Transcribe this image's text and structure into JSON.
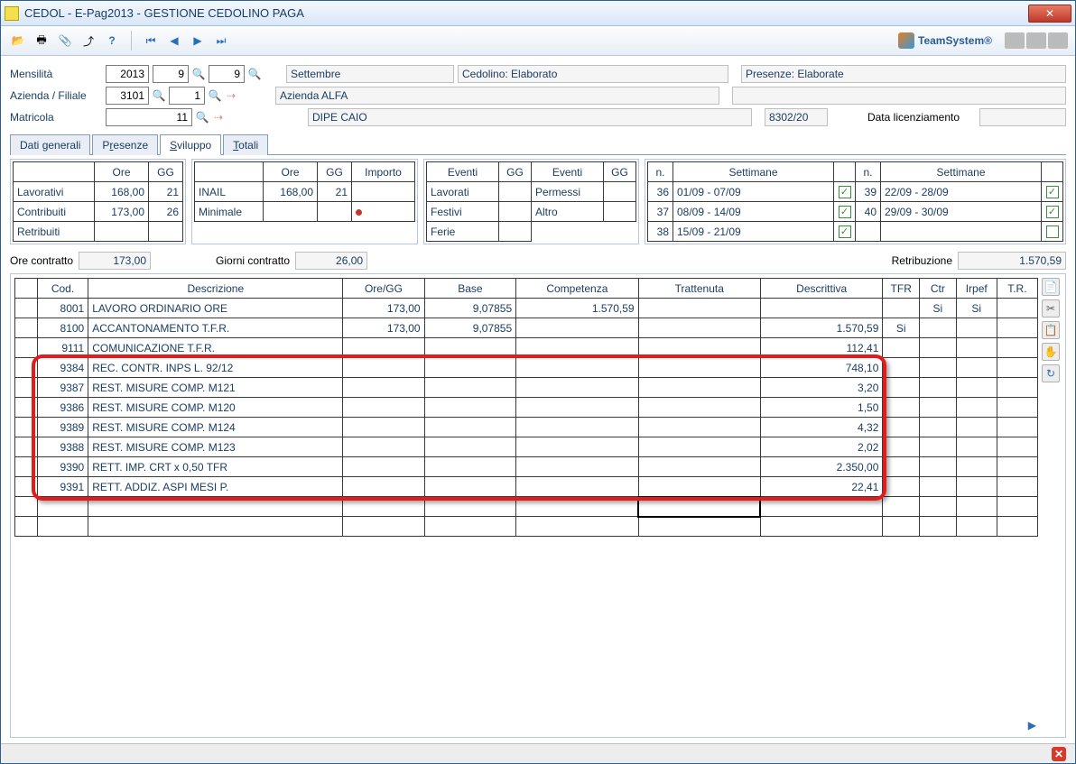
{
  "window": {
    "title": "CEDOL  - E-Pag2013  -  GESTIONE CEDOLINO PAGA"
  },
  "brand": "TeamSystem®",
  "form": {
    "mensilita_label": "Mensilità",
    "azienda_label": "Azienda / Filiale",
    "matricola_label": "Matricola",
    "year": "2013",
    "month1": "9",
    "month2": "9",
    "azienda": "3101",
    "filiale": "1",
    "matricola": "11",
    "month_name": "Settembre",
    "cedolino_status": "Cedolino: Elaborato",
    "presenze_status": "Presenze: Elaborate",
    "azienda_name": "Azienda ALFA",
    "dipe_name": "DIPE CAIO",
    "code": "8302/20",
    "licenziamento_label": "Data licenziamento",
    "licenziamento_value": ""
  },
  "tabs": [
    {
      "label": "Dati generali",
      "hotkey": "g"
    },
    {
      "label": "Presenze",
      "hotkey": "r"
    },
    {
      "label": "Sviluppo",
      "hotkey": "S",
      "active": true
    },
    {
      "label": "Totali",
      "hotkey": "T"
    }
  ],
  "block1": {
    "headers": [
      "",
      "Ore",
      "GG"
    ],
    "rows": [
      [
        "Lavorativi",
        "168,00",
        "21"
      ],
      [
        "Contribuiti",
        "173,00",
        "26"
      ],
      [
        "Retribuiti",
        "",
        ""
      ]
    ]
  },
  "block2": {
    "headers": [
      "",
      "Ore",
      "GG",
      "Importo"
    ],
    "rows": [
      [
        "INAIL",
        "168,00",
        "21",
        ""
      ],
      [
        "Minimale",
        "",
        "",
        ""
      ]
    ]
  },
  "block3": {
    "headers": [
      "Eventi",
      "GG",
      "Eventi",
      "GG"
    ],
    "rows": [
      [
        "Lavorati",
        "",
        "Permessi",
        ""
      ],
      [
        "Festivi",
        "",
        "Altro",
        ""
      ],
      [
        "Ferie",
        "",
        "",
        ""
      ]
    ]
  },
  "block4": {
    "headers": [
      "n.",
      "Settimane",
      "",
      "n.",
      "Settimane",
      ""
    ],
    "rows": [
      [
        "36",
        "01/09 - 07/09",
        "✓",
        "39",
        "22/09 - 28/09",
        "✓"
      ],
      [
        "37",
        "08/09 - 14/09",
        "✓",
        "40",
        "29/09 - 30/09",
        "✓"
      ],
      [
        "38",
        "15/09 - 21/09",
        "✓",
        "",
        "",
        ""
      ]
    ]
  },
  "summary": {
    "ore_contratto_label": "Ore contratto",
    "ore_contratto": "173,00",
    "giorni_contratto_label": "Giorni contratto",
    "giorni_contratto": "26,00",
    "retribuzione_label": "Retribuzione",
    "retribuzione": "1.570,59"
  },
  "grid": {
    "headers": [
      "",
      "Cod.",
      "Descrizione",
      "Ore/GG",
      "Base",
      "Competenza",
      "Trattenuta",
      "Descrittiva",
      "TFR",
      "Ctr",
      "Irpef",
      "T.R."
    ],
    "rows": [
      [
        "",
        "8001",
        "LAVORO ORDINARIO ORE",
        "173,00",
        "9,07855",
        "1.570,59",
        "",
        "",
        "",
        "Si",
        "Si",
        ""
      ],
      [
        "",
        "8100",
        "ACCANTONAMENTO T.F.R.",
        "173,00",
        "9,07855",
        "",
        "",
        "1.570,59",
        "Si",
        "",
        "",
        ""
      ],
      [
        "",
        "9111",
        "COMUNICAZIONE T.F.R.",
        "",
        "",
        "",
        "",
        "112,41",
        "",
        "",
        "",
        ""
      ],
      [
        "",
        "9384",
        "REC. CONTR. INPS L. 92/12",
        "",
        "",
        "",
        "",
        "748,10",
        "",
        "",
        "",
        ""
      ],
      [
        "",
        "9387",
        "REST. MISURE COMP. M121",
        "",
        "",
        "",
        "",
        "3,20",
        "",
        "",
        "",
        ""
      ],
      [
        "",
        "9386",
        "REST. MISURE COMP. M120",
        "",
        "",
        "",
        "",
        "1,50",
        "",
        "",
        "",
        ""
      ],
      [
        "",
        "9389",
        "REST. MISURE COMP. M124",
        "",
        "",
        "",
        "",
        "4,32",
        "",
        "",
        "",
        ""
      ],
      [
        "",
        "9388",
        "REST. MISURE COMP. M123",
        "",
        "",
        "",
        "",
        "2,02",
        "",
        "",
        "",
        ""
      ],
      [
        "",
        "9390",
        "RETT. IMP. CRT x 0,50 TFR",
        "",
        "",
        "",
        "",
        "2.350,00",
        "",
        "",
        "",
        ""
      ],
      [
        "",
        "9391",
        "RETT. ADDIZ. ASPI MESI P.",
        "",
        "",
        "",
        "",
        "22,41",
        "",
        "",
        "",
        ""
      ],
      [
        "",
        "",
        "",
        "",
        "",
        "",
        "",
        "",
        "",
        "",
        "",
        ""
      ],
      [
        "",
        "",
        "",
        "",
        "",
        "",
        "",
        "",
        "",
        "",
        "",
        ""
      ]
    ]
  }
}
